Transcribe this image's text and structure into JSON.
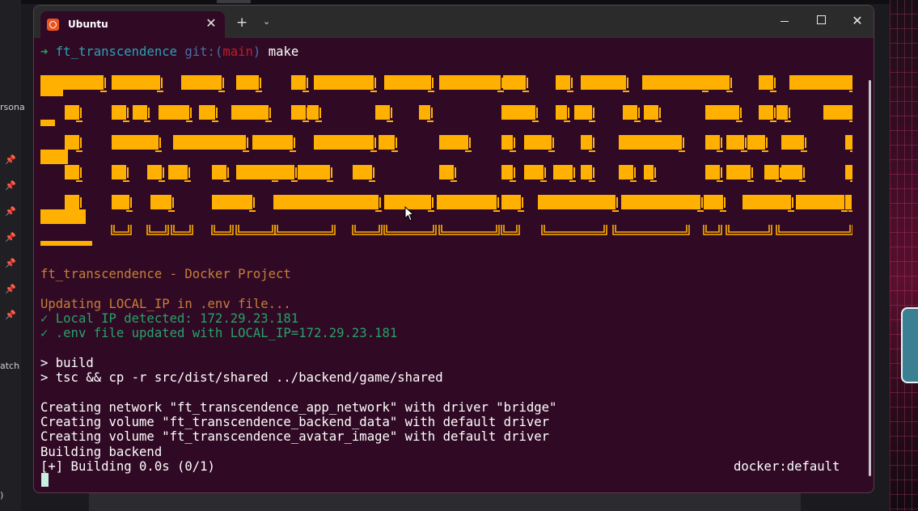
{
  "window": {
    "tab_title": "Ubuntu",
    "tab_close": "✕",
    "new_tab": "+",
    "tab_dropdown": "⌄",
    "close": "✕"
  },
  "prompt": {
    "arrow": "➜",
    "dir": "ft_transcendence",
    "git": "git:(",
    "branch": "main",
    "git_close": ")",
    "command": "make"
  },
  "banner": {
    "color": "#ffb000",
    "text": "FT_TRANSCENDENCE"
  },
  "output": {
    "project_title": "ft_transcendence - Docker Project",
    "updating": "Updating LOCAL_IP in .env file...",
    "ip_detected": "✓ Local IP detected: 172.29.23.181",
    "env_updated": "✓ .env file updated with LOCAL_IP=172.29.23.181",
    "build_cmd": "> build",
    "tsc_cmd": "> tsc && cp -r src/dist/shared ../backend/game/shared",
    "net": "Creating network \"ft_transcendence_app_network\" with driver \"bridge\"",
    "vol1": "Creating volume \"ft_transcendence_backend_data\" with default driver",
    "vol2": "Creating volume \"ft_transcendence_avatar_image\" with default driver",
    "building_backend": "Building backend",
    "building_progress": "[+] Building 0.0s (0/1)",
    "docker_ctx": "docker:default"
  },
  "background": {
    "left_fragments": [
      "rsona",
      "atch",
      ")"
    ],
    "colors": {
      "terminal_bg": "#300a24",
      "green": "#26a269",
      "orange": "#c47f3a",
      "banner": "#ffb000"
    }
  }
}
